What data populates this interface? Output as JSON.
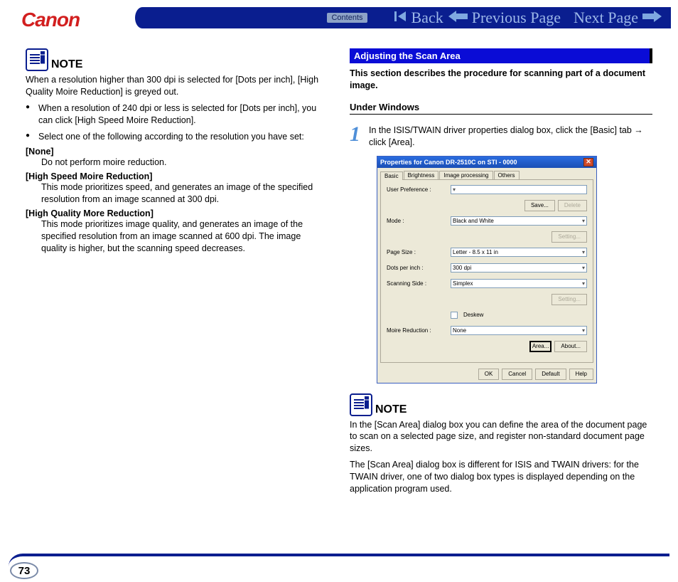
{
  "header": {
    "logo": "Canon",
    "contents": "Contents",
    "back": "Back",
    "prev": "Previous Page",
    "next": "Next Page"
  },
  "left": {
    "note_label": "NOTE",
    "note_intro": "When a resolution higher than 300 dpi is selected for [Dots per inch], [High Quality Moire Reduction] is greyed out.",
    "bullet1": "When a resolution of 240 dpi or less is selected for [Dots per inch], you can click [High Speed Moire Reduction].",
    "bullet2": "Select one of the following according to the resolution you have set:",
    "t_none": "[None]",
    "d_none": "Do not perform moire reduction.",
    "t_hs": "[High Speed Moire Reduction]",
    "d_hs": "This mode prioritizes speed, and generates an image of the specified resolution from an image scanned at 300 dpi.",
    "t_hq": "[High Quality More Reduction]",
    "d_hq": "This mode prioritizes image quality, and generates an image of the specified resolution from an image scanned at 600 dpi. The image quality is higher, but the scanning speed decreases."
  },
  "right": {
    "section": "Adjusting the Scan Area",
    "section_desc": "This section describes the procedure for scanning part of a document image.",
    "subhead": "Under Windows",
    "stepnum": "1",
    "steptext": "In the ISIS/TWAIN driver properties dialog box, click the [Basic] tab → click [Area].",
    "note_label": "NOTE",
    "note1": "In the [Scan Area] dialog box you can define the area of the document page to scan on a selected page size, and register non-standard document page sizes.",
    "note2": "The [Scan Area] dialog box is different for ISIS and TWAIN drivers: for the TWAIN driver, one of two dialog box types is displayed depending on the application program used."
  },
  "dialog": {
    "title": "Properties for Canon DR-2510C on STI - 0000",
    "tabs": {
      "basic": "Basic",
      "brightness": "Brightness",
      "image": "Image processing",
      "others": "Others"
    },
    "rows": {
      "userpref": "User Preference :",
      "mode": "Mode :",
      "pagesize": "Page Size :",
      "dpi": "Dots per inch :",
      "scanside": "Scanning Side :",
      "moire": "Moire Reduction :"
    },
    "vals": {
      "userpref": "",
      "mode": "Black and White",
      "pagesize": "Letter - 8.5 x 11 in",
      "dpi": "300 dpi",
      "scanside": "Simplex",
      "deskew": "Deskew",
      "moire": "None"
    },
    "btns": {
      "save": "Save...",
      "delete": "Delete",
      "setting1": "Setting...",
      "setting2": "Setting...",
      "area": "Area...",
      "about": "About...",
      "ok": "OK",
      "cancel": "Cancel",
      "default": "Default",
      "help": "Help"
    }
  },
  "footer": {
    "page": "73"
  }
}
